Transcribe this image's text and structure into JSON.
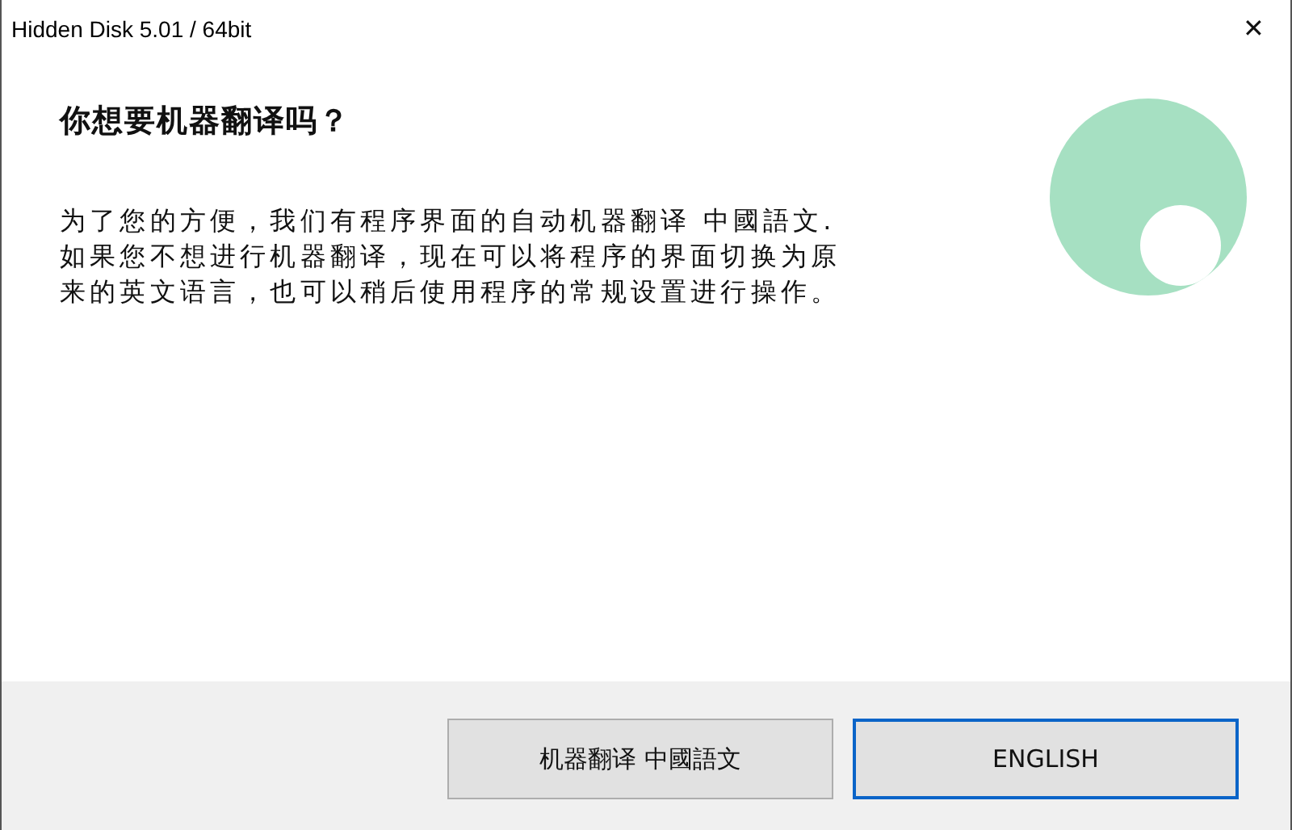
{
  "window": {
    "title": "Hidden Disk 5.01 / 64bit",
    "close": "✕"
  },
  "heading": "你想要机器翻译吗？",
  "message_lines": [
    "为了您的方便，我们有程序界面的自动机器翻译 中國語文.",
    "如果您不想进行机器翻译，现在可以将程序的界面切换为原",
    "来的英文语言，也可以稍后使用程序的常规设置进行操作。"
  ],
  "buttons": [
    {
      "label": "机器翻译 中國語文",
      "focused": false
    },
    {
      "label": "ENGLISH",
      "focused": true
    }
  ]
}
